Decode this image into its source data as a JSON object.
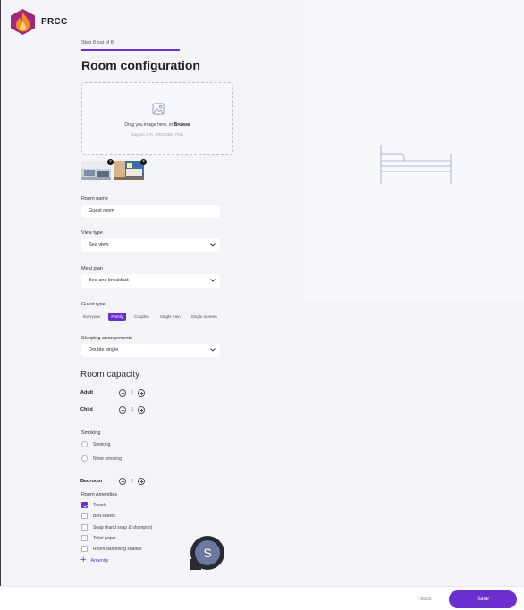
{
  "brand": {
    "name": "PRCC"
  },
  "wizard": {
    "step_text": "Step 8 out of 8",
    "progress": 1.0,
    "title": "Room configuration"
  },
  "upload": {
    "prompt": "Drag you image here, or ",
    "browse": "Browse",
    "supported": "Support JPG, JPEG2000, PNG",
    "thumbnails": [
      {
        "name": "room-photo-1"
      },
      {
        "name": "room-photo-2"
      }
    ]
  },
  "room_name": {
    "label": "Room name",
    "value": "Guest room"
  },
  "view_type": {
    "label": "View type",
    "value": "Sea view"
  },
  "meal_plan": {
    "label": "Meal plan",
    "value": "Bed and breakfast"
  },
  "guest_type": {
    "label": "Guest type",
    "options": [
      "Everyone",
      "Family",
      "Couples",
      "Single men",
      "Single women"
    ],
    "selected": "Family"
  },
  "sleeping": {
    "label": "Sleeping arrangements",
    "value": "Double single"
  },
  "capacity": {
    "title": "Room capacity",
    "adult": {
      "label": "Adult",
      "value": "0"
    },
    "child": {
      "label": "Child",
      "value": "0"
    }
  },
  "smoking": {
    "label": "Smoking",
    "options": [
      "Smoking",
      "None smoking"
    ]
  },
  "bedroom": {
    "label": "Bedroom",
    "value": "0"
  },
  "amenities": {
    "label": "Room Amenities",
    "items": [
      {
        "label": "Towels",
        "checked": true
      },
      {
        "label": "Bed sheets",
        "checked": false
      },
      {
        "label": "Soap (hand soap & shampoo)",
        "checked": false
      },
      {
        "label": "Toilet paper",
        "checked": false
      },
      {
        "label": "Room-darkening shades",
        "checked": false
      }
    ],
    "add_label": "Amenity"
  },
  "avatar": {
    "initial": "S"
  },
  "footer": {
    "back_label": "Back",
    "save_label": "Save"
  },
  "colors": {
    "accent": "#6b2fcf",
    "background": "#f3f4f7"
  }
}
